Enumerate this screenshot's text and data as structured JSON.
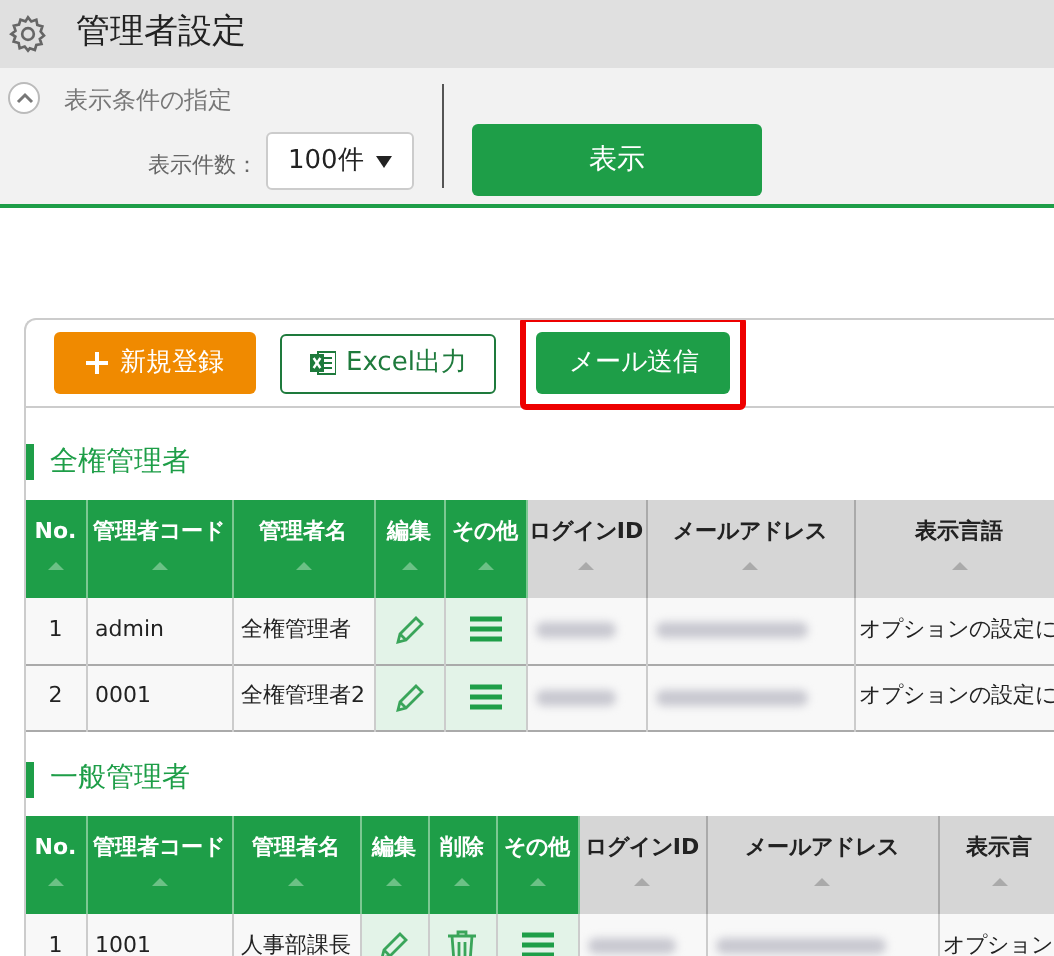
{
  "header": {
    "title": "管理者設定"
  },
  "conditions": {
    "title": "表示条件の指定",
    "expanded": true,
    "count_label": "表示件数：",
    "count_value": "100件",
    "submit": "表示"
  },
  "toolbar": [
    {
      "kind": "add",
      "label": "新規登録",
      "highlighted": false
    },
    {
      "kind": "excel",
      "label": "Excel出力",
      "highlighted": false
    },
    {
      "kind": "mail",
      "label": "メール送信",
      "highlighted": true
    }
  ],
  "sections": [
    {
      "title": "全権管理者",
      "columns": [
        {
          "label": "No.",
          "kind": "green"
        },
        {
          "label": "管理者コード",
          "kind": "green"
        },
        {
          "label": "管理者名",
          "kind": "green"
        },
        {
          "label": "編集",
          "kind": "green"
        },
        {
          "label": "その他",
          "kind": "green"
        },
        {
          "label": "ログインID",
          "kind": "gray"
        },
        {
          "label": "メールアドレス",
          "kind": "gray"
        },
        {
          "label": "表示言語",
          "kind": "gray"
        }
      ],
      "rows": [
        [
          {
            "kind": "num",
            "text": "1"
          },
          {
            "kind": "text",
            "text": "admin"
          },
          {
            "kind": "text",
            "text": "全権管理者"
          },
          {
            "kind": "edit"
          },
          {
            "kind": "menu"
          },
          {
            "kind": "blurred"
          },
          {
            "kind": "blurred"
          },
          {
            "kind": "text",
            "text": "オプションの設定に"
          }
        ],
        [
          {
            "kind": "num",
            "text": "2"
          },
          {
            "kind": "text",
            "text": "0001"
          },
          {
            "kind": "text",
            "text": "全権管理者2"
          },
          {
            "kind": "edit"
          },
          {
            "kind": "menu"
          },
          {
            "kind": "blurred"
          },
          {
            "kind": "blurred"
          },
          {
            "kind": "text",
            "text": "オプションの設定に"
          }
        ]
      ]
    },
    {
      "title": "一般管理者",
      "columns": [
        {
          "label": "No.",
          "kind": "green"
        },
        {
          "label": "管理者コード",
          "kind": "green"
        },
        {
          "label": "管理者名",
          "kind": "green"
        },
        {
          "label": "編集",
          "kind": "green"
        },
        {
          "label": "削除",
          "kind": "green"
        },
        {
          "label": "その他",
          "kind": "green"
        },
        {
          "label": "ログインID",
          "kind": "gray"
        },
        {
          "label": "メールアドレス",
          "kind": "gray"
        },
        {
          "label": "表示言",
          "kind": "gray"
        }
      ],
      "rows": [
        [
          {
            "kind": "num",
            "text": "1"
          },
          {
            "kind": "text",
            "text": "1001"
          },
          {
            "kind": "text",
            "text": "人事部課長"
          },
          {
            "kind": "edit"
          },
          {
            "kind": "delete"
          },
          {
            "kind": "menu"
          },
          {
            "kind": "blurred"
          },
          {
            "kind": "blurred"
          },
          {
            "kind": "text",
            "text": "オプション"
          }
        ]
      ]
    }
  ]
}
